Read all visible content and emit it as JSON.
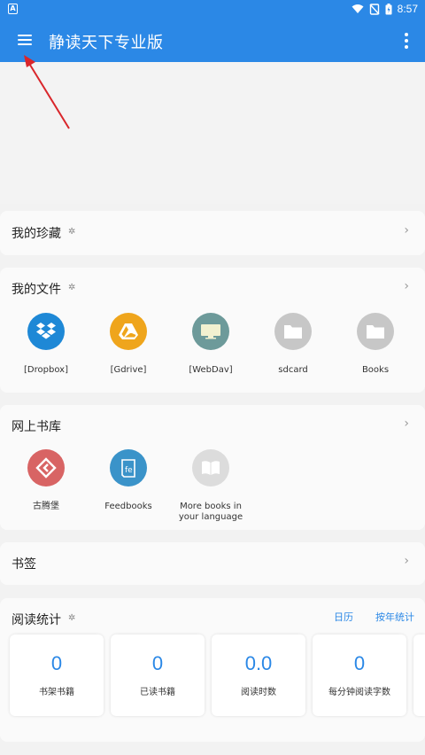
{
  "status_bar": {
    "time": "8:57",
    "app_badge": "A"
  },
  "app_bar": {
    "title": "静读天下专业版"
  },
  "favorites": {
    "title": "我的珍藏"
  },
  "my_files": {
    "title": "我的文件",
    "items": [
      {
        "label": "[Dropbox]",
        "icon": "dropbox-icon",
        "color": "#1e88d6"
      },
      {
        "label": "[Gdrive]",
        "icon": "google-drive-icon",
        "color": "#efa51c"
      },
      {
        "label": "[WebDav]",
        "icon": "monitor-icon",
        "color": "#6d9a9a"
      },
      {
        "label": "sdcard",
        "icon": "folder-icon",
        "color": "#c7c7c7"
      },
      {
        "label": "Books",
        "icon": "folder-icon",
        "color": "#c7c7c7"
      }
    ]
  },
  "online_library": {
    "title": "网上书库",
    "items": [
      {
        "label": "古腾堡",
        "icon": "gutenberg-icon",
        "color": "#d86464"
      },
      {
        "label": "Feedbooks",
        "icon": "feedbooks-icon",
        "color": "#3a93c9"
      },
      {
        "label": "More books in your language",
        "icon": "open-book-icon",
        "color": "#dcdcdc"
      }
    ]
  },
  "bookmarks": {
    "title": "书签"
  },
  "reading_stats": {
    "title": "阅读统计",
    "calendar_link": "日历",
    "yearly_link": "按年统计",
    "tiles": [
      {
        "value": "0",
        "caption": "书架书籍"
      },
      {
        "value": "0",
        "caption": "已读书籍"
      },
      {
        "value": "0.0",
        "caption": "阅读时数"
      },
      {
        "value": "0",
        "caption": "每分钟阅读字数"
      }
    ]
  },
  "colors": {
    "primary": "#2b88e6",
    "background": "#f2f2f2",
    "card": "#fafafa",
    "annotation_arrow": "#d9262b"
  }
}
